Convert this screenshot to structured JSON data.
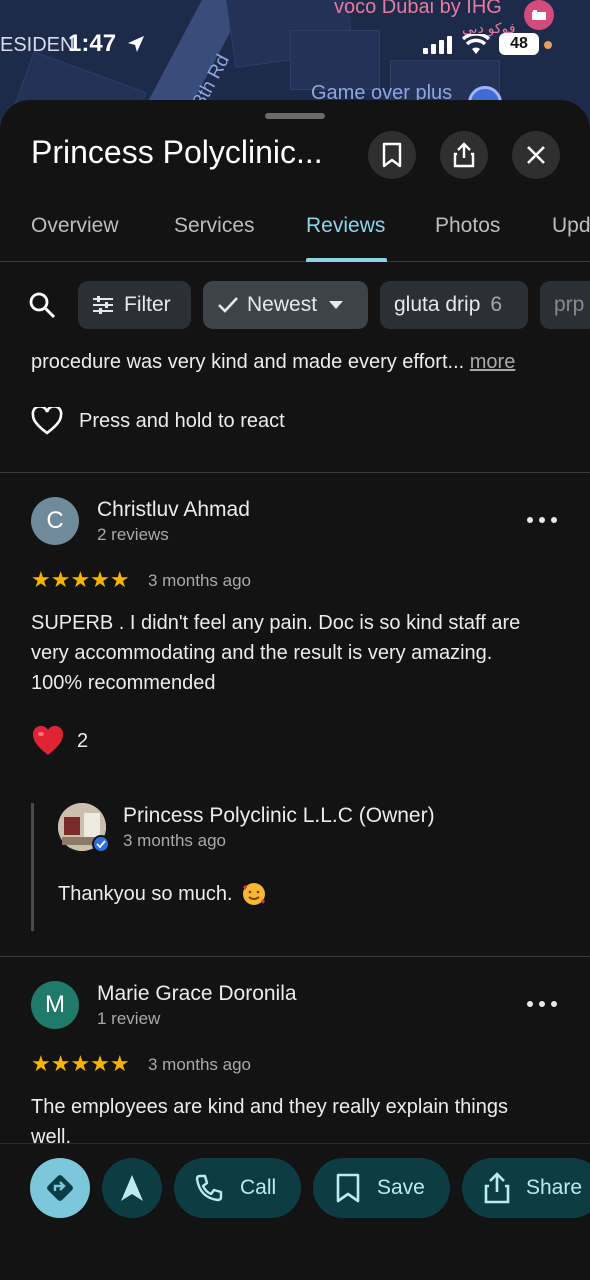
{
  "map": {
    "label_hotel": "voco Dubai by IHG",
    "label_hotel_ar": "فوكو دبي",
    "label_road": "8th Rd",
    "label_game": "Game over plus"
  },
  "status_bar": {
    "residence_fragment": "ESIDEN",
    "time": "1:47",
    "battery": "48"
  },
  "header": {
    "title": "Princess Polyclinic..."
  },
  "tabs": [
    {
      "label": "Overview"
    },
    {
      "label": "Services"
    },
    {
      "label": "Reviews",
      "active": true
    },
    {
      "label": "Photos"
    },
    {
      "label": "Upd"
    }
  ],
  "filters": {
    "filter_label": "Filter",
    "sort_label": "Newest",
    "topic_label": "gluta drip",
    "topic_count": "6",
    "next_topic": "prp"
  },
  "previous_review": {
    "snippet": "procedure was very kind and made every effort...",
    "more": "more",
    "react_hint": "Press and hold to react"
  },
  "reviews": [
    {
      "initial": "C",
      "avatar_color": "#6f8a9a",
      "author": "Christluv Ahmad",
      "meta": "2 reviews",
      "stars": "★★★★★",
      "when": "3 months ago",
      "text_lines": [
        "SUPERB . I didn't feel any pain. Doc is so kind staff are",
        "very accommodating and the result is very amazing.",
        "100% recommended"
      ],
      "reaction_count": "2",
      "owner_reply": {
        "name": "Princess Polyclinic L.L.C (Owner)",
        "when": "3 months ago",
        "text": "Thankyou so much."
      }
    },
    {
      "initial": "M",
      "avatar_color": "#1f7a6a",
      "author": "Marie Grace Doronila",
      "meta": "1 review",
      "stars": "★★★★★",
      "when": "3 months ago",
      "text_lines": [
        "The employees are kind and they really explain things",
        "well."
      ]
    }
  ],
  "action_bar": {
    "call": "Call",
    "save": "Save",
    "share": "Share"
  },
  "colors": {
    "accent": "#8fd3e8",
    "star": "#f5b400",
    "action_bg": "#0d3d44"
  }
}
